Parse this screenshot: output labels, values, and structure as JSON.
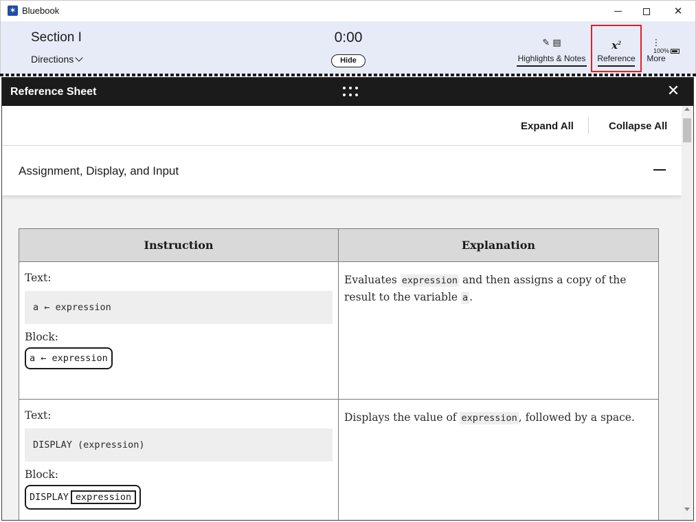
{
  "window": {
    "app_title": "Bluebook",
    "minimize_label": "minimize",
    "maximize_label": "maximize",
    "close_label": "close"
  },
  "header": {
    "section_title": "Section I",
    "directions_label": "Directions",
    "timer": "0:00",
    "hide_label": "Hide",
    "battery": "100%",
    "tools": {
      "highlights_notes": "Highlights & Notes",
      "reference": "Reference",
      "more": "More"
    }
  },
  "reference_sheet": {
    "title": "Reference Sheet",
    "expand_all": "Expand All",
    "collapse_all": "Collapse All",
    "section_title": "Assignment, Display, and Input",
    "columns": [
      "Instruction",
      "Explanation"
    ],
    "rows": [
      {
        "text_label": "Text:",
        "text_code": "a ← expression",
        "block_label": "Block:",
        "block_code": "a ← expression",
        "explanation_parts": [
          "Evaluates ",
          "expression",
          " and then assigns a copy of the result to the variable ",
          "a",
          "."
        ]
      },
      {
        "text_label": "Text:",
        "text_code": "DISPLAY (expression)",
        "block_label": "Block:",
        "block_keyword": "DISPLAY",
        "block_arg": "expression",
        "explanation_parts": [
          "Displays the value of ",
          "expression",
          ", followed by a space."
        ]
      }
    ]
  },
  "icons": {
    "app": "bluebook-logo-icon",
    "highlight": "highlighter-pen-icon",
    "notes": "note-pad-icon",
    "reference": "x-squared-icon",
    "more": "vertical-ellipsis-icon",
    "battery": "battery-icon",
    "drag": "drag-grid-icon",
    "close": "close-icon",
    "collapse": "minus-icon"
  },
  "colors": {
    "header_bg": "#e6ebf7",
    "panel_titlebar": "#1b1b1b",
    "highlight_border": "#e02020"
  }
}
